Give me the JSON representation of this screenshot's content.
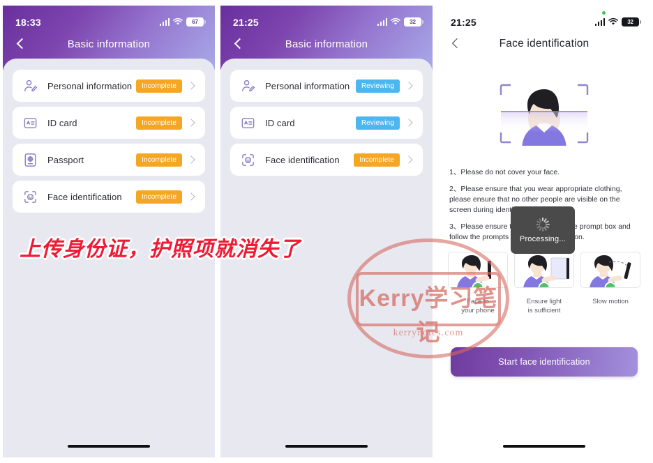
{
  "panels": [
    {
      "id": "basic-info-incomplete",
      "status": {
        "time": "18:33",
        "battery": "67"
      },
      "nav": {
        "title": "Basic information"
      },
      "items": [
        {
          "icon": "person-edit-icon",
          "label": "Personal information",
          "badge": "Incomplete",
          "badge_kind": "incomplete"
        },
        {
          "icon": "id-card-icon",
          "label": "ID card",
          "badge": "Incomplete",
          "badge_kind": "incomplete"
        },
        {
          "icon": "passport-icon",
          "label": "Passport",
          "badge": "Incomplete",
          "badge_kind": "incomplete"
        },
        {
          "icon": "face-scan-icon",
          "label": "Face identification",
          "badge": "Incomplete",
          "badge_kind": "incomplete"
        }
      ]
    },
    {
      "id": "basic-info-reviewing",
      "status": {
        "time": "21:25",
        "battery": "32"
      },
      "nav": {
        "title": "Basic information"
      },
      "items": [
        {
          "icon": "person-edit-icon",
          "label": "Personal information",
          "badge": "Reviewing",
          "badge_kind": "reviewing"
        },
        {
          "icon": "id-card-icon",
          "label": "ID card",
          "badge": "Reviewing",
          "badge_kind": "reviewing"
        },
        {
          "icon": "face-scan-icon",
          "label": "Face identification",
          "badge": "Incomplete",
          "badge_kind": "incomplete"
        }
      ]
    },
    {
      "id": "face-identification",
      "status": {
        "time": "21:25",
        "battery": "32"
      },
      "nav": {
        "title": "Face identification"
      },
      "instructions": [
        "1、Please do not cover your face.",
        "2、Please ensure that you wear appropriate clothing, please ensure that no other people are visible on the screen during identification process.",
        "3、Please ensure that your face fits the prompt box and follow the prompts to complete the action."
      ],
      "tips": [
        {
          "icon": "face-to-phone-illustration",
          "label": "Face to\nyour phone"
        },
        {
          "icon": "good-lighting-illustration",
          "label": "Ensure light\nis sufficient"
        },
        {
          "icon": "slow-motion-illustration",
          "label": "Slow motion"
        }
      ],
      "start_button": "Start face identification",
      "toast": {
        "text": "Processing..."
      }
    }
  ],
  "annotation": {
    "text": "上传身份证，护照项就消失了",
    "color": "#ef1b35"
  },
  "watermark": {
    "title": "Kerry学习笔记",
    "url": "kerrynotes.com",
    "color": "#d4685f"
  },
  "colors": {
    "header_gradient_start": "#6a2f9e",
    "header_gradient_end": "#a8a9e8",
    "badge_incomplete": "#f5a623",
    "badge_reviewing": "#4cb6ef",
    "sheet_bg": "#e8e8f0",
    "check_green": "#4ec367"
  }
}
